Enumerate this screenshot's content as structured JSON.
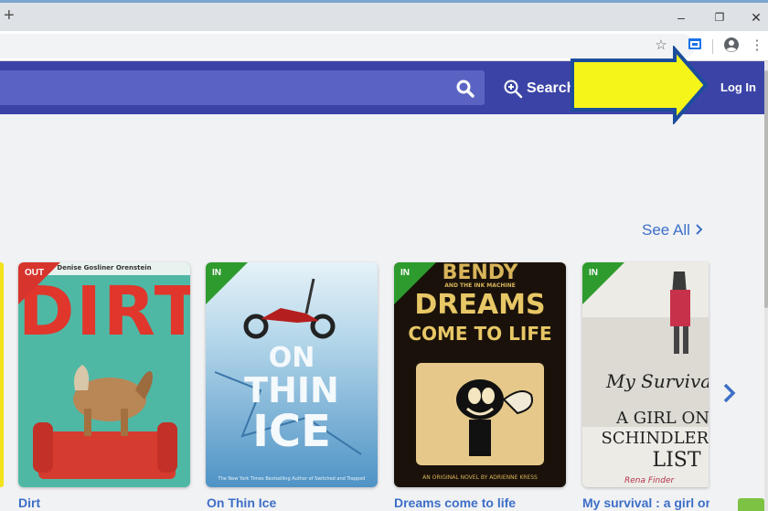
{
  "browser": {
    "new_tab": "+",
    "minimize": "–",
    "restore": "❐",
    "close": "✕",
    "toolbar_icons": [
      "star-icon",
      "extension-icon",
      "profile-icon",
      "menu-icon"
    ]
  },
  "header": {
    "advanced_search_label": "Search",
    "login_label": "Log In",
    "colors": {
      "bar": "#3b44a6",
      "search_field": "#5a63c2",
      "arrow": "#f5f51a",
      "arrow_outline": "#1c4d9c"
    }
  },
  "carousel": {
    "see_all": "See All",
    "books": [
      {
        "title": "Dirt",
        "status": "OUT",
        "cover_text": "DIRT",
        "cover_top_text": "Denise Gosliner Orenstein"
      },
      {
        "title": "On Thin Ice",
        "status": "IN",
        "cover_text": [
          "ON",
          "THIN",
          "ICE"
        ],
        "cover_bottom_text": "The New York Times Bestselling Author of Switched and Trapped"
      },
      {
        "title": "Dreams come to life",
        "status": "IN",
        "cover_top_text": "BENDY",
        "cover_sub_text": "AND THE INK MACHINE",
        "cover_text": [
          "DREAMS",
          "COME TO LIFE"
        ],
        "cover_bottom_text": "AN ORIGINAL NOVEL BY ADRIENNE KRESS"
      },
      {
        "title": "My survival : a girl on",
        "status": "IN",
        "cover_script": "My Survival",
        "cover_text": [
          "A GIRL ON",
          "SCHINDLER'S",
          "LIST"
        ],
        "cover_bottom_text": "Rena Finder"
      }
    ],
    "status_colors": {
      "OUT": "#d6342c",
      "IN": "#2e9b2e"
    }
  }
}
